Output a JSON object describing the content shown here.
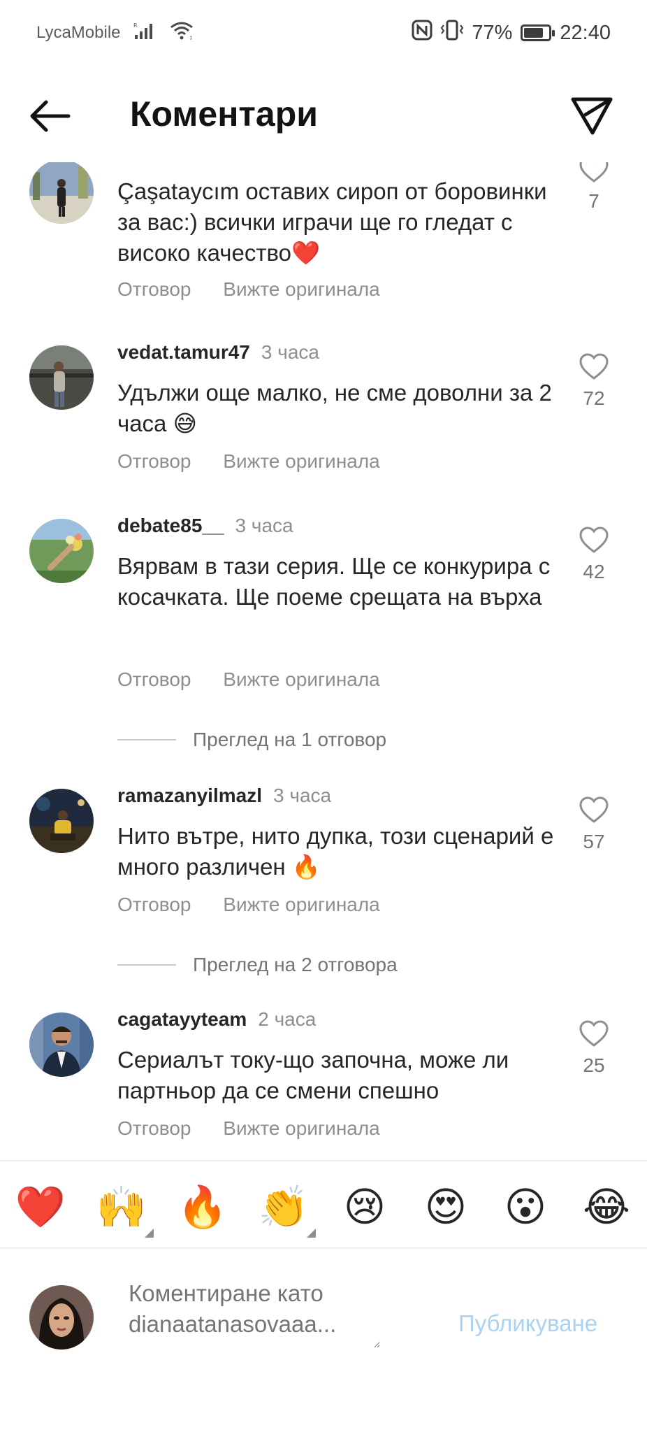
{
  "status_bar": {
    "carrier": "LycaMobile",
    "battery_percent": "77%",
    "battery_level": 0.77,
    "time": "22:40",
    "icons": [
      "signal-icon",
      "wifi-icon",
      "nfc-icon",
      "vibrate-icon",
      "battery-icon"
    ]
  },
  "header": {
    "title": "Коментари",
    "back_icon": "back-arrow-icon",
    "share_icon": "send-icon"
  },
  "comments": [
    {
      "username": "",
      "time": "",
      "text": "Çaşataycım оставих сироп от боровинки за вас:) всички играчи ще го гледат с високо качество❤️",
      "likes": "7",
      "reply_label": "Отговор",
      "original_label": "Вижте оригинала"
    },
    {
      "username": "vedat.tamur47",
      "time": "3 часа",
      "text": "Удължи още малко, не сме доволни за 2 часа 😅",
      "likes": "72",
      "reply_label": "Отговор",
      "original_label": "Вижте оригинала"
    },
    {
      "username": "debate85__",
      "time": "3 часа",
      "text": "Вярвам в тази серия. Ще се конкурира с косачката. Ще поеме срещата на върха",
      "likes": "42",
      "reply_label": "Отговор",
      "original_label": "Вижте оригинала",
      "view_replies": "Преглед на 1 отговор"
    },
    {
      "username": "ramazanyilmazl",
      "time": "3 часа",
      "text": "Нито вътре, нито дупка, този сценарий е много различен 🔥",
      "likes": "57",
      "reply_label": "Отговор",
      "original_label": "Вижте оригинала",
      "view_replies": "Преглед на 2 отговора"
    },
    {
      "username": "cagatayyteam",
      "time": "2 часа",
      "text": "Сериалът току-що започна, може ли партньор да се смени спешно",
      "likes": "25",
      "reply_label": "Отговор",
      "original_label": "Вижте оригинала"
    }
  ],
  "emoji_bar": [
    "❤️",
    "🙌",
    "🔥",
    "👏",
    "😢",
    "😍",
    "😮",
    "😂"
  ],
  "composer": {
    "placeholder": "Коментиране като dianaatanasovaaa...",
    "post_label": "Публикуване"
  },
  "colors": {
    "text": "#262626",
    "secondary": "#8e8e8e",
    "post_button": "#a9d3f0"
  }
}
